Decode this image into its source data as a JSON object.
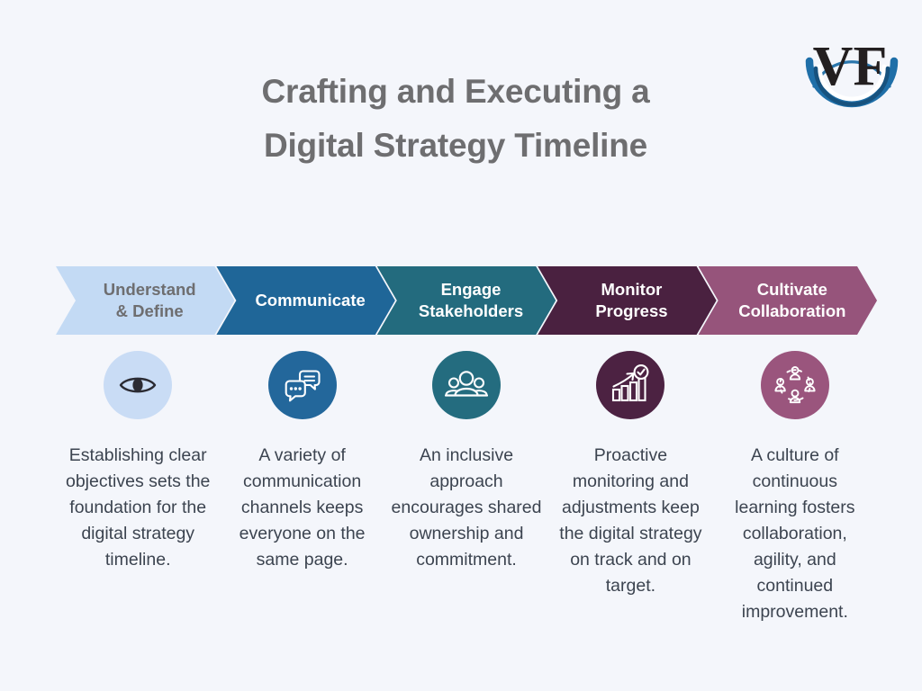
{
  "page": {
    "background_color": "#f4f6fb",
    "title_color": "#6e6e70",
    "body_text_color": "#3c4450"
  },
  "logo": {
    "name": "vf-monogram-logo",
    "letters": "VF",
    "mark_color": "#231f20",
    "arc_color": "#1f6fa8",
    "arc_color_dark": "#17527e"
  },
  "header": {
    "title_line1": "Crafting and Executing a",
    "title_line2": "Digital Strategy Timeline"
  },
  "steps": [
    {
      "label": "Understand\n& Define",
      "chevron_color": "#c3daf4",
      "label_color": "#6e6e70",
      "icon": "eye-icon",
      "icon_circle_color": "#c9dcf5",
      "icon_stroke_color": "#2b2b33",
      "description": "Establishing clear objectives sets the foundation for the digital strategy timeline."
    },
    {
      "label": "Communicate",
      "chevron_color": "#1f6698",
      "label_color": "#ffffff",
      "icon": "speech-bubbles-icon",
      "icon_circle_color": "#23679b",
      "icon_stroke_color": "#ffffff",
      "description": "A variety of communication channels keeps everyone on the same page."
    },
    {
      "label": "Engage\nStakeholders",
      "chevron_color": "#236b7e",
      "label_color": "#ffffff",
      "icon": "people-group-icon",
      "icon_circle_color": "#246c7f",
      "icon_stroke_color": "#ffffff",
      "description": "An inclusive approach encourages shared ownership and commitment."
    },
    {
      "label": "Monitor\nProgress",
      "chevron_color": "#4a2140",
      "label_color": "#ffffff",
      "icon": "bar-chart-check-icon",
      "icon_circle_color": "#4c2242",
      "icon_stroke_color": "#ffffff",
      "description": "Proactive monitoring and adjustments keep the digital strategy on track and on target."
    },
    {
      "label": "Cultivate\nCollaboration",
      "chevron_color": "#96547b",
      "label_color": "#ffffff",
      "icon": "collaboration-network-icon",
      "icon_circle_color": "#9a557d",
      "icon_stroke_color": "#ffffff",
      "description": "A culture of continuous learning fosters collaboration, agility, and continued improvement."
    }
  ]
}
